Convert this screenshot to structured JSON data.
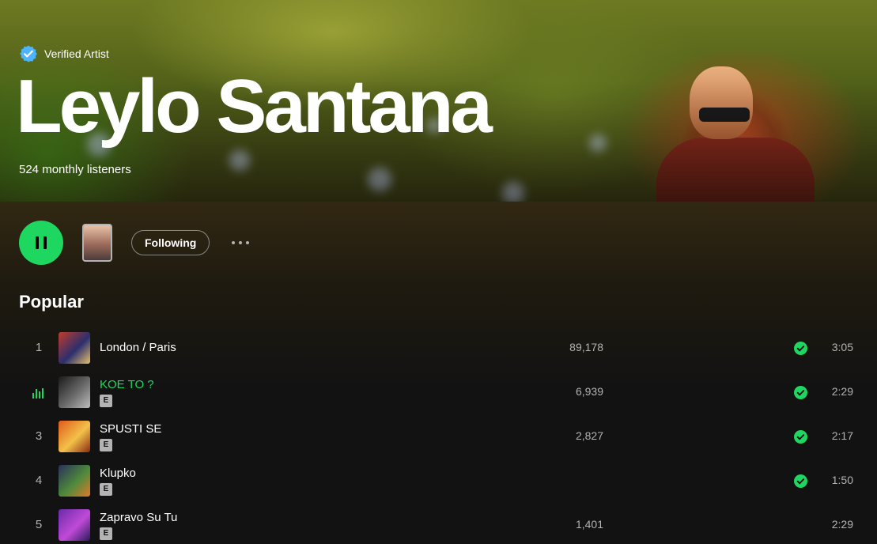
{
  "artist": {
    "verified_label": "Verified Artist",
    "name": "Leylo Santana",
    "monthly_listeners": "524 monthly listeners"
  },
  "actions": {
    "play_state": "pause-icon",
    "follow_label": "Following",
    "more_icon": "more-options-icon"
  },
  "popular": {
    "heading": "Popular",
    "tracks": [
      {
        "index": "1",
        "title": "London / Paris",
        "plays": "89,178",
        "duration": "3:05",
        "explicit": false,
        "saved": true,
        "playing": false,
        "cover_colors": [
          "#c23a2a",
          "#2b2f6e",
          "#e8c16a"
        ]
      },
      {
        "index": "2",
        "title": "KOE TO ?",
        "plays": "6,939",
        "duration": "2:29",
        "explicit": true,
        "explicit_label": "E",
        "saved": true,
        "playing": true,
        "cover_colors": [
          "#1a1a1a",
          "#6b6b6b",
          "#bdbdbd"
        ]
      },
      {
        "index": "3",
        "title": "SPUSTI SE",
        "plays": "2,827",
        "duration": "2:17",
        "explicit": true,
        "explicit_label": "E",
        "saved": true,
        "playing": false,
        "cover_colors": [
          "#e05a1a",
          "#f2c14a",
          "#8a2a10"
        ]
      },
      {
        "index": "4",
        "title": "Klupko",
        "plays": "",
        "duration": "1:50",
        "explicit": true,
        "explicit_label": "E",
        "saved": true,
        "playing": false,
        "cover_colors": [
          "#2a2f5c",
          "#4f8a3a",
          "#e07a2a"
        ]
      },
      {
        "index": "5",
        "title": "Zapravo Su Tu",
        "plays": "1,401",
        "duration": "2:29",
        "explicit": true,
        "explicit_label": "E",
        "saved": false,
        "playing": false,
        "cover_colors": [
          "#6a2aa8",
          "#c04ad8",
          "#2a1a5a"
        ]
      }
    ]
  },
  "colors": {
    "accent": "#1ed760",
    "verified_badge": "#4cb3ff",
    "background": "#121212",
    "muted_text": "#b3b3b3"
  }
}
